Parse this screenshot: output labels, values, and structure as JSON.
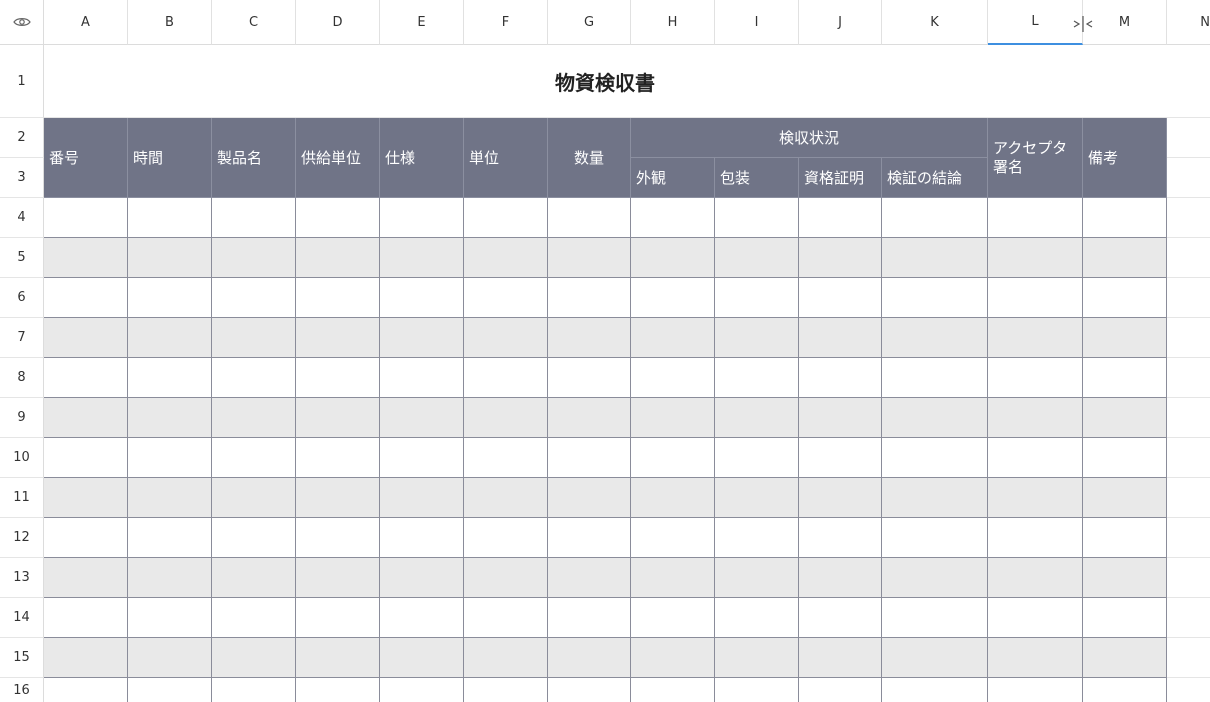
{
  "columns": [
    "A",
    "B",
    "C",
    "D",
    "E",
    "F",
    "G",
    "H",
    "I",
    "J",
    "K",
    "L",
    "M",
    "N"
  ],
  "rows": [
    "1",
    "2",
    "3",
    "4",
    "5",
    "6",
    "7",
    "8",
    "9",
    "10",
    "11",
    "12",
    "13",
    "14",
    "15",
    "16"
  ],
  "selected_column": "L",
  "sheet": {
    "title": "物資検収書",
    "headers": {
      "number": "番号",
      "time": "時間",
      "product": "製品名",
      "supplier": "供給単位",
      "spec": "仕様",
      "unit": "単位",
      "quantity": "数量",
      "inspection_group": "検収状況",
      "appearance": "外観",
      "packaging": "包装",
      "certificate": "資格証明",
      "conclusion": "検証の結論",
      "acceptor_sign": "アクセプタ\n署名",
      "remarks": "備考"
    }
  },
  "colors": {
    "header_bg": "#707487",
    "alt_row": "#e9e9e9",
    "selection": "#3d8fe0"
  },
  "icons": {
    "corner": "eye-icon",
    "column_resize": "column-resize-icon"
  }
}
